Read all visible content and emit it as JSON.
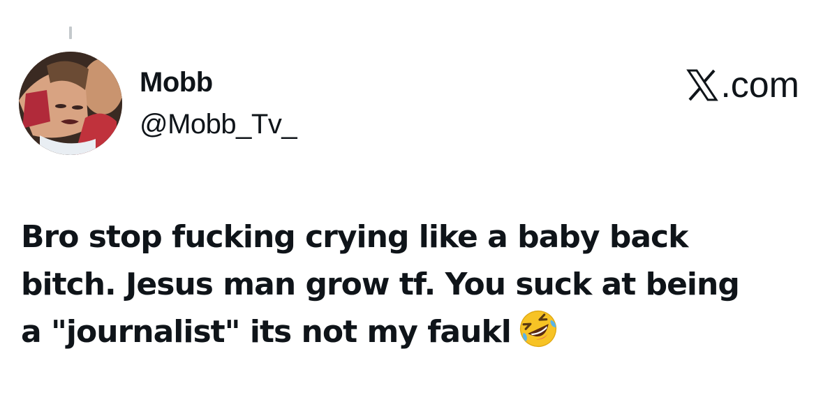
{
  "tweet": {
    "display_name": "Mobb",
    "handle": "@Mobb_Tv_",
    "brand_label": ".com",
    "brand_icon": "x-logo-icon",
    "text_lines": [
      "Bro stop fucking crying like a baby back",
      "bitch. Jesus man grow tf. You suck at being",
      "a \"journalist\" its not my faukl"
    ],
    "emoji": "rolling-on-floor-laughing-emoji"
  },
  "colors": {
    "text": "#0f1419",
    "background": "#ffffff",
    "emoji_face": "#f7c325"
  }
}
